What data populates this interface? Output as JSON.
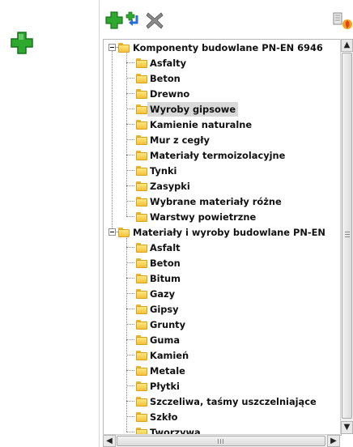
{
  "toolbar": {
    "icons": [
      "add-icon",
      "add-child-icon",
      "delete-icon",
      "edit-icon"
    ],
    "colors": {
      "add": "#2fa82f",
      "arrow": "#2a6fd6",
      "delete": "#8a8a8a"
    }
  },
  "tree": {
    "groups": [
      {
        "label": "Komponenty budowlane PN-EN 6946",
        "expanded": true,
        "children": [
          "Asfalty",
          "Beton",
          "Drewno",
          "Wyroby gipsowe",
          "Kamienie naturalne",
          "Mur z cegły",
          "Materiały termoizolacyjne",
          "Tynki",
          "Zasypki",
          "Wybrane materiały różne",
          "Warstwy powietrzne"
        ]
      },
      {
        "label": "Materiały i wyroby budowlane PN-EN",
        "expanded": true,
        "children": [
          "Asfalt",
          "Beton",
          "Bitum",
          "Gazy",
          "Gipsy",
          "Grunty",
          "Guma",
          "Kamień",
          "Metale",
          "Płytki",
          "Szczeliwa, taśmy uszczelniające",
          "Szkło",
          "Tworzywa"
        ]
      }
    ],
    "selected": "Wyroby gipsowe"
  }
}
